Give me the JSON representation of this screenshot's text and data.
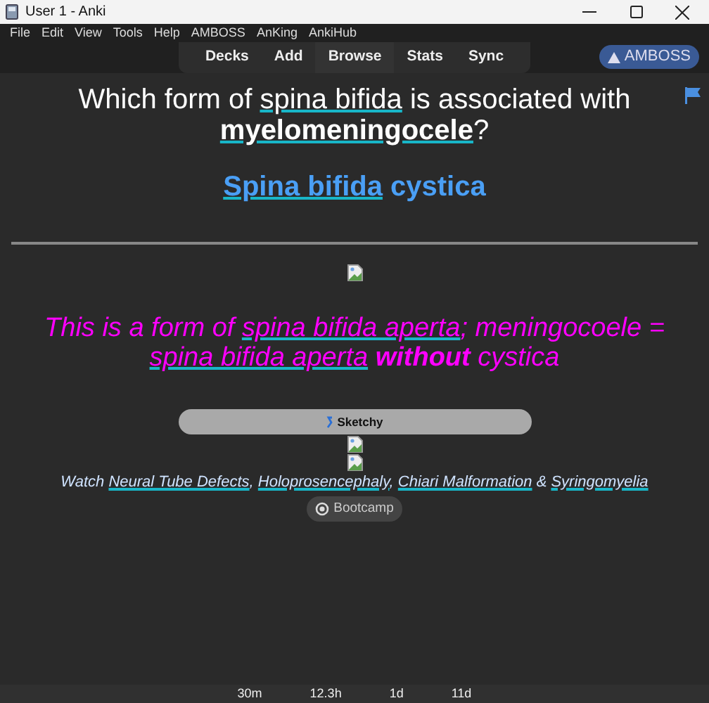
{
  "window": {
    "title": "User 1 - Anki"
  },
  "menu": [
    "File",
    "Edit",
    "View",
    "Tools",
    "Help",
    "AMBOSS",
    "AnKing",
    "AnkiHub"
  ],
  "toolbar": [
    "Decks",
    "Add",
    "Browse",
    "Stats",
    "Sync"
  ],
  "amboss_button": "AMBOSS",
  "card": {
    "question": [
      {
        "text": "Which form of ",
        "kind": "text"
      },
      {
        "text": "spina bifida",
        "kind": "link"
      },
      {
        "text": " is associated with ",
        "kind": "text"
      },
      {
        "text": "myelomeningocele",
        "kind": "bold_link"
      },
      {
        "text": "?",
        "kind": "text"
      }
    ],
    "answer": [
      {
        "text": "Spina bifida",
        "kind": "link"
      },
      {
        "text": " cystica",
        "kind": "text"
      }
    ],
    "extra": [
      {
        "text": "This is a form of ",
        "kind": "text"
      },
      {
        "text": "spina bifida aperta",
        "kind": "link"
      },
      {
        "text": "; meningocoele = ",
        "kind": "text"
      },
      {
        "text": "spina bifida aperta",
        "kind": "link"
      },
      {
        "text": " without",
        "kind": "bold"
      },
      {
        "text": " cystica",
        "kind": "text"
      }
    ],
    "sketchy_button": "Sketchy",
    "watch": [
      {
        "text": "Watch ",
        "kind": "text"
      },
      {
        "text": "Neural Tube Defects",
        "kind": "link"
      },
      {
        "text": ", ",
        "kind": "text"
      },
      {
        "text": "Holoprosencephaly",
        "kind": "link"
      },
      {
        "text": ", ",
        "kind": "text"
      },
      {
        "text": "Chiari Malformation",
        "kind": "link"
      },
      {
        "text": " & ",
        "kind": "text"
      },
      {
        "text": "Syringomyelia",
        "kind": "link"
      }
    ],
    "bootcamp_button": "Bootcamp"
  },
  "answer_intervals": [
    "30m",
    "12.3h",
    "1d",
    "11d"
  ]
}
